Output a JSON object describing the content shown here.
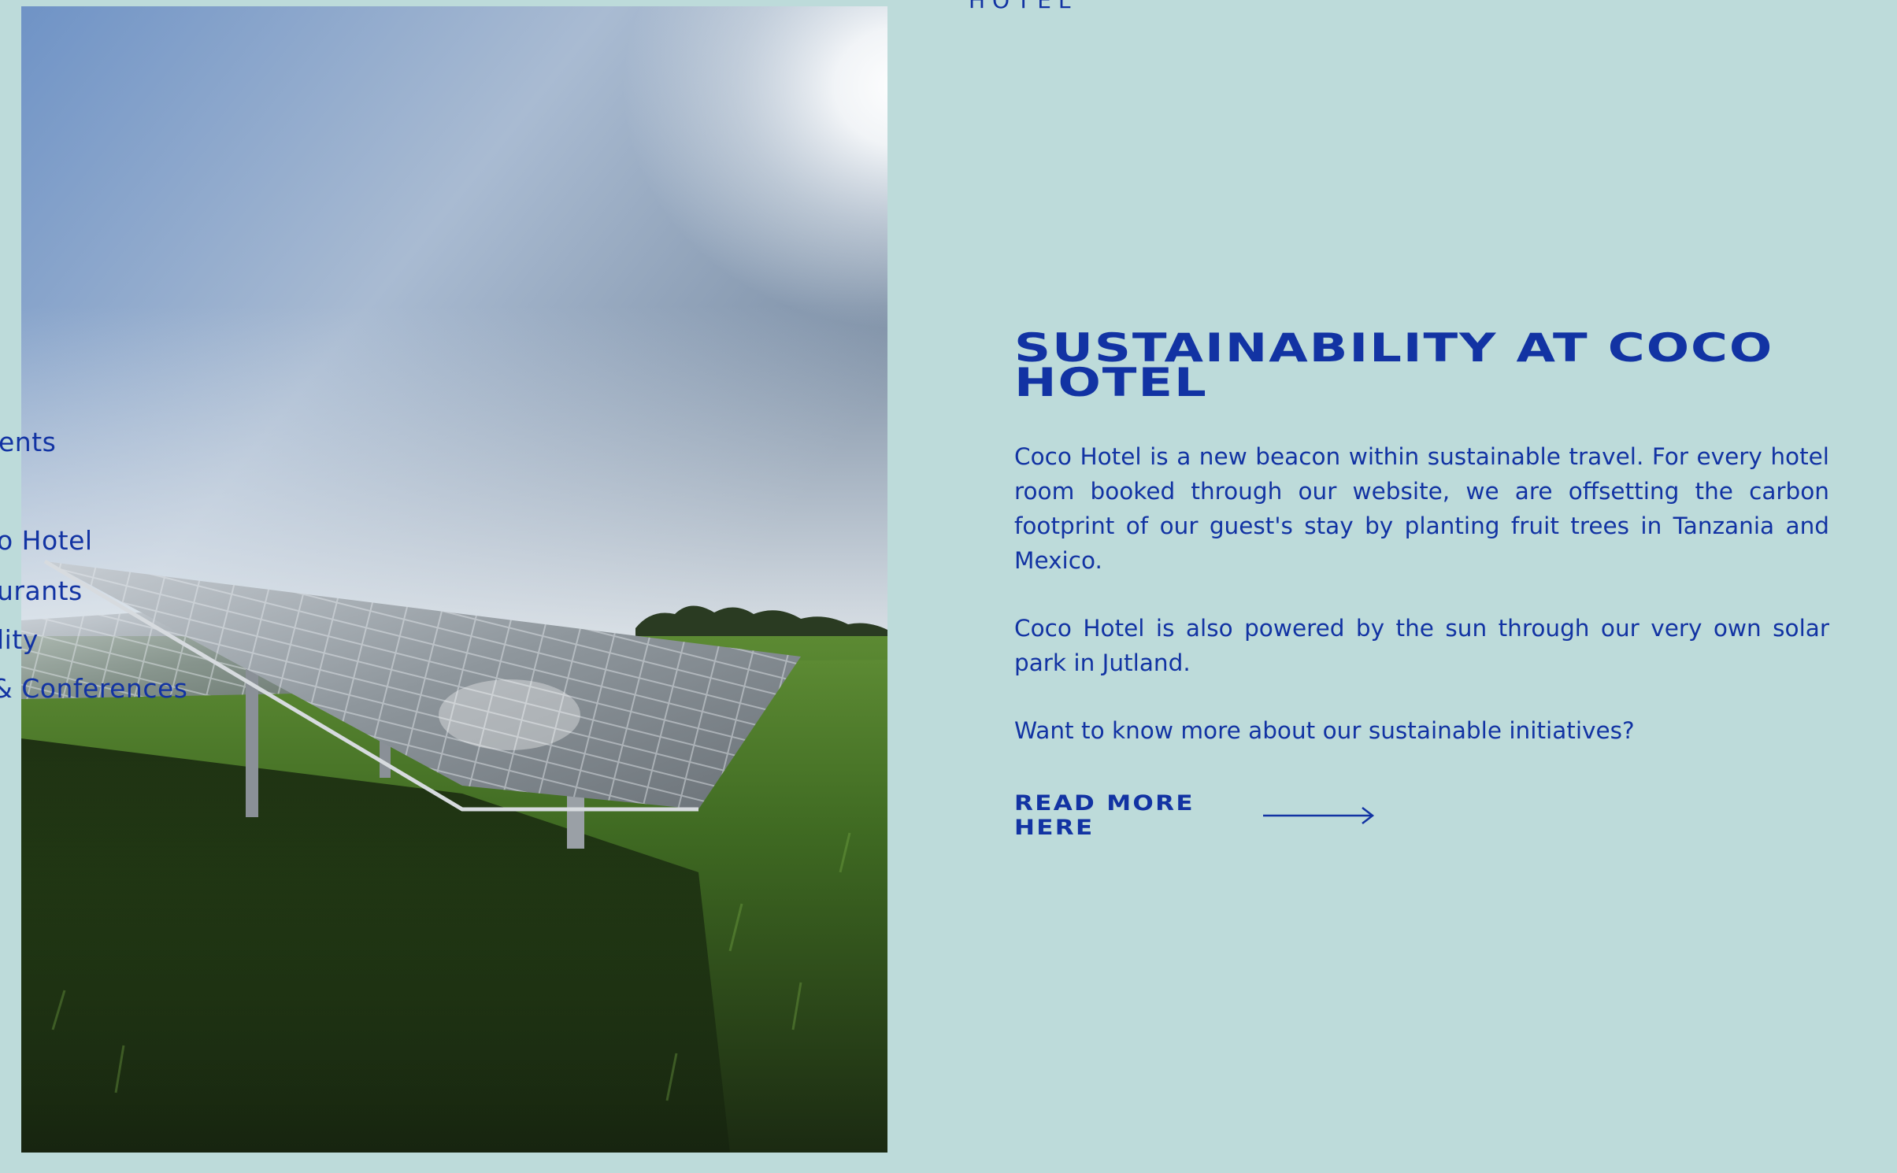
{
  "header": {
    "brand_fragment": "HOTEL"
  },
  "side_nav": {
    "items": [
      {
        "label": "ents"
      },
      {
        "label": "o Hotel"
      },
      {
        "label": "urants"
      },
      {
        "label": "lity"
      },
      {
        "label": "& Conferences"
      }
    ]
  },
  "hero_image": {
    "subject": "solar panels in a green field under a bright sun"
  },
  "main": {
    "title": "SUSTAINABILITY AT COCO HOTEL",
    "paragraphs": [
      "Coco Hotel is a new beacon within sustainable travel. For every hotel room booked through our website, we are offsetting the carbon footprint of our guest's stay by planting fruit trees in Tanzania and Mexico.",
      "Coco Hotel is also powered by the sun through our very own solar park in Jutland.",
      "Want to know more about our sustainable initiatives?"
    ],
    "cta_label": "READ MORE HERE"
  },
  "colors": {
    "background": "#bddbda",
    "accent": "#1233a3"
  },
  "icons": {
    "cta_arrow": "arrow-right-icon"
  }
}
